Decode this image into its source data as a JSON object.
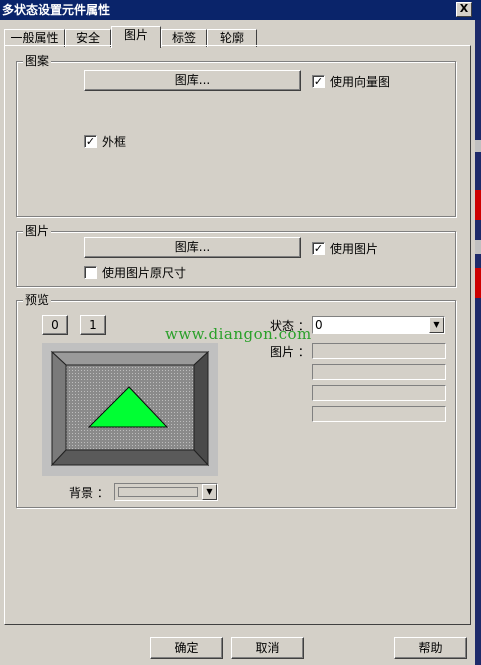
{
  "window": {
    "title": "多状态设置元件属性",
    "close_label": "X"
  },
  "tabs": [
    {
      "label": "一般属性"
    },
    {
      "label": "安全"
    },
    {
      "label": "图片"
    },
    {
      "label": "标签"
    },
    {
      "label": "轮廓"
    }
  ],
  "active_tab": "图片",
  "pattern_group": {
    "title": "图案",
    "library_button": "图库...",
    "use_vector_label": "使用向量图",
    "use_vector_checked": true,
    "frame_label": "外框",
    "frame_checked": true
  },
  "picture_group": {
    "title": "图片",
    "library_button": "图库...",
    "use_picture_label": "使用图片",
    "use_picture_checked": true,
    "original_size_label": "使用图片原尺寸",
    "original_size_checked": false
  },
  "preview_group": {
    "title": "预览",
    "state_buttons": [
      "0",
      "1"
    ],
    "state_label": "状态 ：",
    "state_value": "0",
    "picture_label": "图片 ：",
    "background_label": "背景 ：",
    "shape_fill_color": "#00ff33",
    "bevel_color": "#6e6e6e"
  },
  "watermark": "www.diangon.com",
  "footer": {
    "ok_label": "确定",
    "cancel_label": "取消",
    "help_label": "帮助"
  },
  "check_mark": "✓",
  "dropdown_glyph": "▼"
}
